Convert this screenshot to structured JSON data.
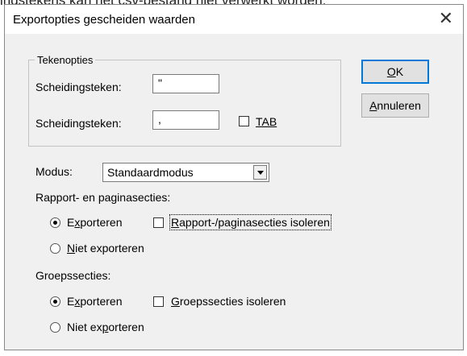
{
  "background_text": "ingstekens kan het csv-bestand niet verwerkt worden.",
  "dialog": {
    "title": "Exportopties gescheiden waarden",
    "close_symbol": "✕"
  },
  "tekenopties": {
    "legend": "Tekenopties",
    "scheiding1_label": "Scheidingsteken:",
    "scheiding1_value": "\"",
    "scheiding2_label": "Scheidingsteken:",
    "scheiding2_value": ",",
    "tab_label": "TAB",
    "tab_checked": false
  },
  "buttons": {
    "ok_mnemonic": "O",
    "ok_rest": "K",
    "cancel_mnemonic": "A",
    "cancel_rest": "nnuleren"
  },
  "modus": {
    "label": "Modus:",
    "selected": "Standaardmodus"
  },
  "rapport": {
    "heading": "Rapport- en paginasecties:",
    "export_pre": "E",
    "export_mnemonic": "x",
    "export_rest": "porteren",
    "isolate_mnemonic": "R",
    "isolate_rest": "apport-/paginasecties isoleren",
    "noexport_mnemonic": "N",
    "noexport_rest": "iet exporteren",
    "selected": "export",
    "isolate_checked": false
  },
  "groep": {
    "heading": "Groepssecties:",
    "export_pre": "E",
    "export_mnemonic": "x",
    "export_rest": "porteren",
    "isolate_mnemonic": "G",
    "isolate_rest": "roepssecties isoleren",
    "noexport_pre": "Niet ex",
    "noexport_mnemonic": "p",
    "noexport_rest": "orteren",
    "selected": "export",
    "isolate_checked": false
  }
}
